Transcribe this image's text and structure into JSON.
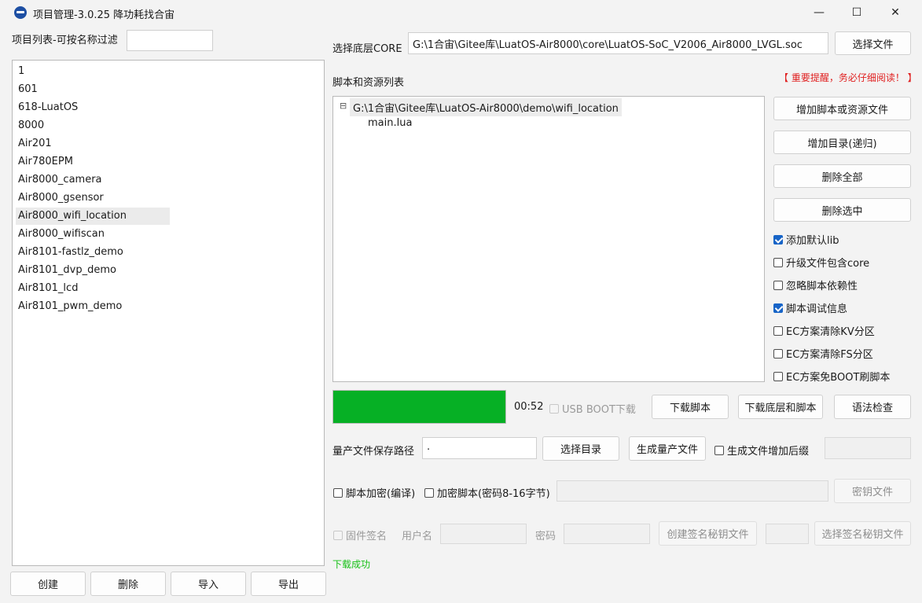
{
  "window": {
    "title": "项目管理-3.0.25 降功耗找合宙",
    "minimize": "—",
    "maximize": "☐",
    "close": "✕"
  },
  "project_list": {
    "filter_label": "项目列表-可按名称过滤",
    "filter_value": "",
    "items": [
      "1",
      "601",
      "618-LuatOS",
      "8000",
      "Air201",
      "Air780EPM",
      "Air8000_camera",
      "Air8000_gsensor",
      "Air8000_wifi_location",
      "Air8000_wifiscan",
      "Air8101-fastlz_demo",
      "Air8101_dvp_demo",
      "Air8101_lcd",
      "Air8101_pwm_demo"
    ],
    "selected": "Air8000_wifi_location",
    "buttons": {
      "create": "创建",
      "delete": "删除",
      "import": "导入",
      "export": "导出"
    }
  },
  "core": {
    "label": "选择底层CORE",
    "path": "G:\\1合宙\\Gitee库\\LuatOS-Air8000\\core\\LuatOS-SoC_V2006_Air8000_LVGL.soc",
    "select_button": "选择文件"
  },
  "scripts": {
    "label": "脚本和资源列表",
    "warning": "【 重要提醒，务必仔细阅读！ 】",
    "tree_expander": "⊟",
    "tree_root": "G:\\1合宙\\Gitee库\\LuatOS-Air8000\\demo\\wifi_location",
    "tree_children": [
      "main.lua"
    ],
    "buttons": {
      "add_files": "增加脚本或资源文件",
      "add_dir": "增加目录(递归)",
      "delete_all": "删除全部",
      "delete_selected": "删除选中"
    }
  },
  "options": [
    {
      "label": "添加默认lib",
      "checked": true
    },
    {
      "label": "升级文件包含core",
      "checked": false
    },
    {
      "label": "忽略脚本依赖性",
      "checked": false
    },
    {
      "label": "脚本调试信息",
      "checked": true
    },
    {
      "label": "EC方案清除KV分区",
      "checked": false
    },
    {
      "label": "EC方案清除FS分区",
      "checked": false
    },
    {
      "label": "EC方案免BOOT刷脚本",
      "checked": false
    }
  ],
  "download": {
    "progress": 1.0,
    "progress_color": "#06b025",
    "time": "00:52",
    "usb_boot_label": "USB BOOT下载",
    "download_script": "下载脚本",
    "download_core_script": "下载底层和脚本",
    "syntax_check": "语法检查"
  },
  "mass_production": {
    "label": "量产文件保存路径",
    "path": ".",
    "select_dir": "选择目录",
    "generate": "生成量产文件",
    "suffix_label": "生成文件增加后缀",
    "suffix_value": ""
  },
  "encryption": {
    "encrypt_label": "脚本加密(编译)",
    "encrypt_pw_label": "加密脚本(密码8-16字节)",
    "password_value": "",
    "key_file": "密钥文件"
  },
  "signing": {
    "firmware_sign": "固件签名",
    "username_label": "用户名",
    "username_value": "",
    "password_label": "密码",
    "password_value": "",
    "create_key": "创建签名秘钥文件",
    "key_value": "",
    "select_key": "选择签名秘钥文件"
  },
  "status": {
    "text": "下载成功",
    "color": "#16c016"
  }
}
